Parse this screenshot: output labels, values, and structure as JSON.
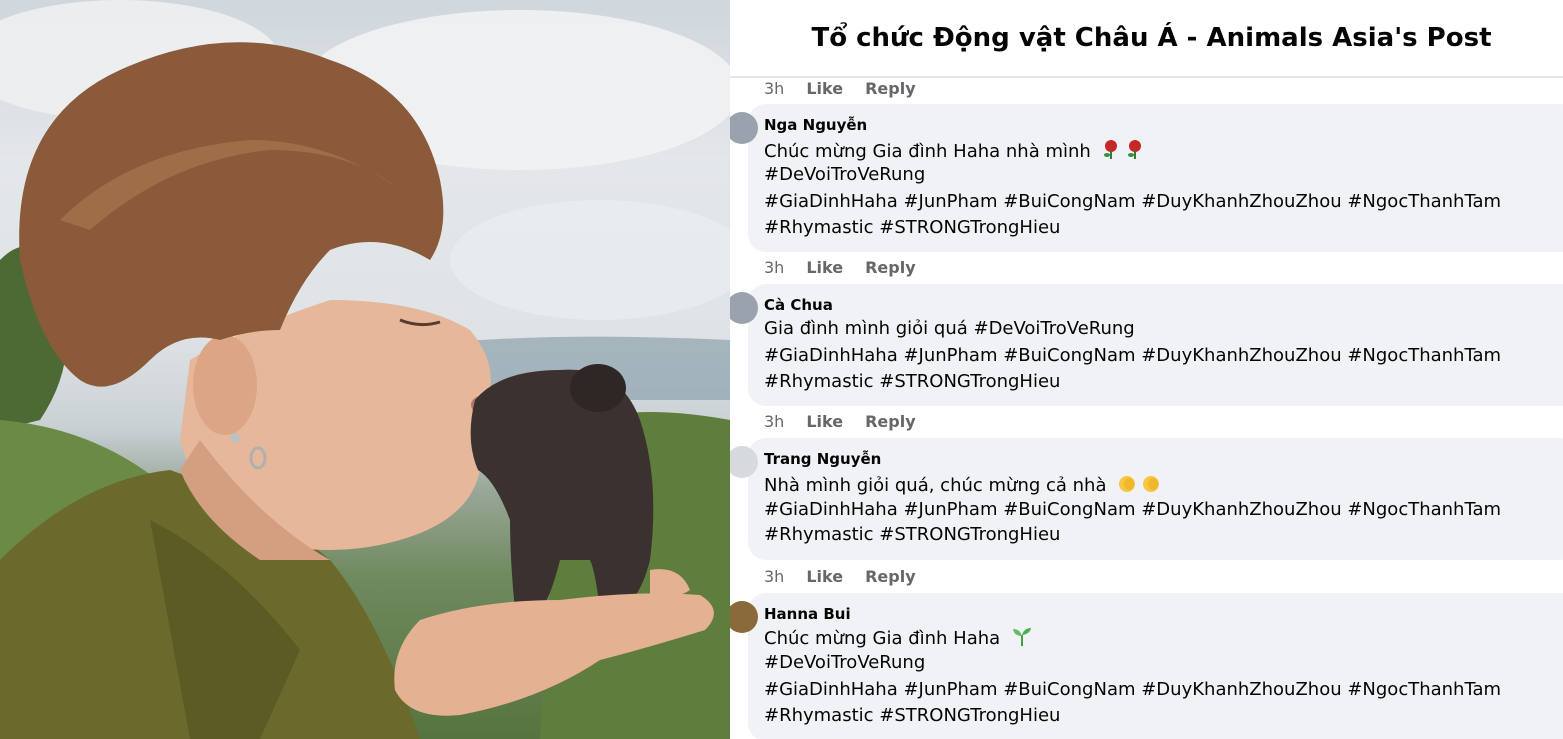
{
  "post": {
    "title": "Tổ chức Động vật Châu Á - Animals Asia's Post"
  },
  "top_actions": {
    "time": "3h",
    "like": "Like",
    "reply": "Reply"
  },
  "comments": [
    {
      "author": "Nga Nguyễn",
      "lines": [
        "Chúc mừng Gia đình Haha nhà mình",
        "#DeVoiTroVeRung",
        "#GiaDinhHaha #JunPham #BuiCongNam #DuyKhanhZhouZhou #NgocThanhTam",
        "#Rhymastic #STRONGTrongHieu"
      ],
      "emoji": "rose-icon",
      "time": "3h",
      "like": "Like",
      "reply": "Reply"
    },
    {
      "author": "Cà Chua",
      "lines": [
        "Gia đình mình giỏi quá #DeVoiTroVeRung",
        "#GiaDinhHaha #JunPham #BuiCongNam #DuyKhanhZhouZhou #NgocThanhTam",
        "#Rhymastic #STRONGTrongHieu"
      ],
      "time": "3h",
      "like": "Like",
      "reply": "Reply"
    },
    {
      "author": "Trang Nguyễn",
      "lines": [
        "Nhà mình giỏi quá, chúc mừng cả nhà",
        "#GiaDinhHaha #JunPham #BuiCongNam #DuyKhanhZhouZhou #NgocThanhTam",
        "#Rhymastic #STRONGTrongHieu"
      ],
      "emoji": "clapping-hands-icon",
      "time": "3h",
      "like": "Like",
      "reply": "Reply"
    },
    {
      "author": "Hanna Bui",
      "lines": [
        "Chúc mừng Gia đình Haha",
        "#DeVoiTroVeRung",
        "#GiaDinhHaha #JunPham #BuiCongNam #DuyKhanhZhouZhou #NgocThanhTam",
        "#Rhymastic #STRONGTrongHieu"
      ],
      "emoji": "seedling-icon"
    }
  ],
  "colors": {
    "comment_bg": "#f0f2f5",
    "text": "#050505",
    "meta": "#65676b"
  }
}
